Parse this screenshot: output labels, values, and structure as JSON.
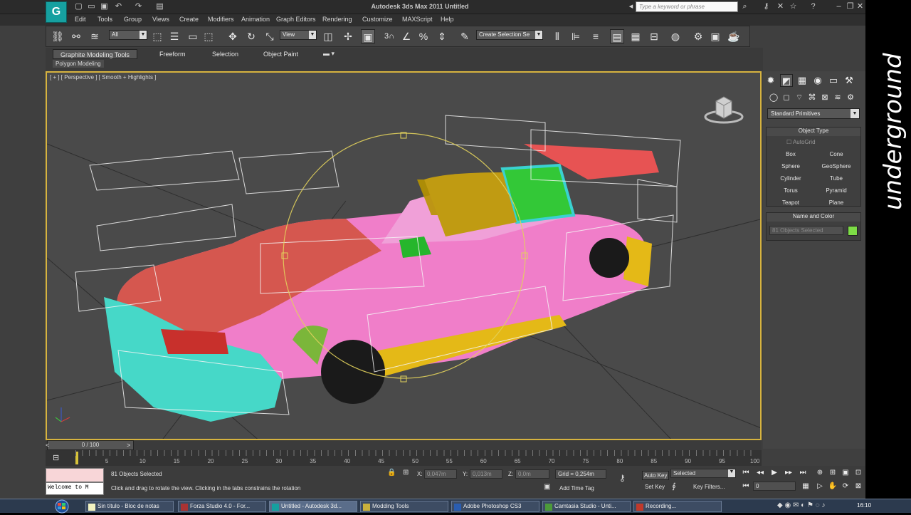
{
  "titlebar": {
    "title": "Autodesk 3ds Max  2011      Untitled",
    "search_placeholder": "Type a keyword or phrase"
  },
  "menu": [
    "Edit",
    "Tools",
    "Group",
    "Views",
    "Create",
    "Modifiers",
    "Animation",
    "Graph Editors",
    "Rendering",
    "Customize",
    "MAXScript",
    "Help"
  ],
  "toolbar": {
    "filter": "All",
    "refcoord": "View",
    "named_selection": "Create Selection Se",
    "snap_label": "3"
  },
  "ribbon": {
    "tabs": [
      "Graphite Modeling Tools",
      "Freeform",
      "Selection",
      "Object Paint"
    ],
    "sub_tab": "Polygon Modeling"
  },
  "viewport": {
    "label": "[ + ] [ Perspective ] [ Smooth + Highlights ]"
  },
  "command_panel": {
    "dropdown": "Standard Primitives",
    "object_type_title": "Object Type",
    "autogrid": "AutoGrid",
    "primitives": [
      "Box",
      "Cone",
      "Sphere",
      "GeoSphere",
      "Cylinder",
      "Tube",
      "Torus",
      "Pyramid",
      "Teapot",
      "Plane"
    ],
    "name_color_title": "Name and Color",
    "name_value": "81 Objects Selected",
    "color_swatch": "#7ddc46"
  },
  "timeline": {
    "frame": "0 / 100",
    "ticks": [
      "5",
      "10",
      "15",
      "20",
      "25",
      "30",
      "35",
      "40",
      "45",
      "50",
      "55",
      "60",
      "65",
      "70",
      "75",
      "80",
      "85",
      "90",
      "95",
      "100"
    ]
  },
  "status": {
    "maxscript_text": "Welcome to M",
    "selection": "81 Objects Selected",
    "prompt": "Click and drag to rotate the view.  Clicking in the tabs constrains the rotation",
    "x_label": "X:",
    "x_value": "0,047m",
    "y_label": "Y:",
    "y_value": "0,013m",
    "z_label": "Z:",
    "z_value": "0,0m",
    "grid": "Grid = 0,254m",
    "add_time_tag": "Add Time Tag",
    "auto_key": "Auto Key",
    "set_key": "Set Key",
    "selected": "Selected",
    "key_filters": "Key Filters...",
    "frame_value": "0"
  },
  "taskbar": {
    "items": [
      "Sin título - Bloc de notas",
      "Forza Studio 4.0 - For...",
      "Untitled - Autodesk 3d...",
      "Modding Tools",
      "Adobe Photoshop CS3",
      "Camtasia Studio - Unti...",
      "Recording..."
    ],
    "clock": "16:10"
  },
  "watermark": "underground"
}
